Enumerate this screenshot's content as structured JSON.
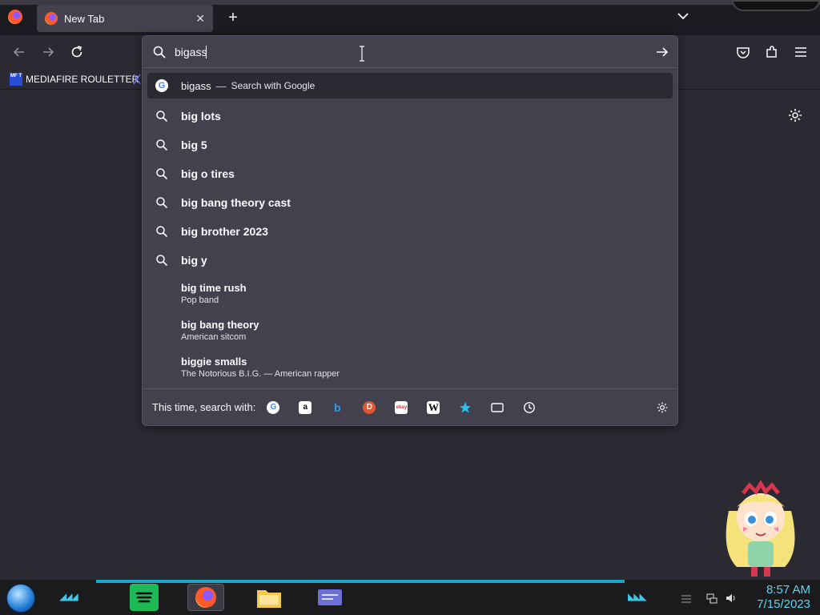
{
  "browser": {
    "tab_title": "New Tab",
    "new_tab_symbol": "+",
    "close_symbol": "✕"
  },
  "bookmarks": [
    {
      "label": "MEDIAFIRE ROULETTER",
      "icon_text": "MF T"
    }
  ],
  "urlbar": {
    "query": "bigass"
  },
  "results": {
    "top": {
      "query": "bigass",
      "separator": "—",
      "action": "Search with Google"
    },
    "suggestions": [
      "big lots",
      "big 5",
      "big o tires",
      "big bang theory cast",
      "big brother 2023",
      "big y"
    ],
    "rich": [
      {
        "title": "big time rush",
        "subtitle": "Pop band"
      },
      {
        "title": "big bang theory",
        "subtitle": "American sitcom"
      },
      {
        "title": "biggie smalls",
        "subtitle": "The Notorious B.I.G. — American rapper"
      }
    ]
  },
  "oneoff": {
    "label": "This time, search with:",
    "engines": [
      {
        "name": "google-icon",
        "glyph": "G",
        "color": "#4285f4",
        "bg": "#ffffff"
      },
      {
        "name": "amazon-icon",
        "glyph": "a",
        "color": "#000000",
        "bg": "#ffffff"
      },
      {
        "name": "bing-icon",
        "glyph": "b",
        "color": "#2aa0f0",
        "bg": "transparent"
      },
      {
        "name": "duckduckgo-icon",
        "glyph": "D",
        "color": "#ffffff",
        "bg": "#de5833"
      },
      {
        "name": "ebay-icon",
        "glyph": "ebay",
        "color": "#e53238",
        "bg": "#ffffff"
      },
      {
        "name": "wikipedia-icon",
        "glyph": "W",
        "color": "#000000",
        "bg": "#ffffff"
      }
    ]
  },
  "taskbar": {
    "time": "8:57 AM",
    "date": "7/15/2023"
  },
  "colors": {
    "accent": "#18a8c9",
    "clock": "#5ed3f3"
  }
}
